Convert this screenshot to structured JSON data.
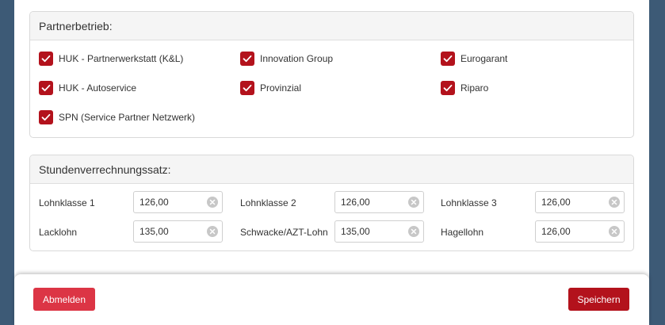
{
  "partner": {
    "title": "Partnerbetrieb:",
    "items": [
      {
        "label": "HUK - Partnerwerkstatt (K&L)",
        "checked": true
      },
      {
        "label": "Innovation Group",
        "checked": true
      },
      {
        "label": "Eurogarant",
        "checked": true
      },
      {
        "label": "HUK - Autoservice",
        "checked": true
      },
      {
        "label": "Provinzial",
        "checked": true
      },
      {
        "label": "Riparo",
        "checked": true
      },
      {
        "label": "SPN (Service Partner Netzwerk)",
        "checked": true
      }
    ]
  },
  "rates": {
    "title": "Stundenverrechnungssatz:",
    "fields": [
      {
        "label": "Lohnklasse 1",
        "value": "126,00"
      },
      {
        "label": "Lohnklasse 2",
        "value": "126,00"
      },
      {
        "label": "Lohnklasse 3",
        "value": "126,00"
      },
      {
        "label": "Lacklohn",
        "value": "135,00"
      },
      {
        "label": "Schwacke/AZT-Lohn",
        "value": "135,00"
      },
      {
        "label": "Hagellohn",
        "value": "126,00"
      }
    ]
  },
  "footer": {
    "logout_label": "Abmelden",
    "save_label": "Speichern"
  },
  "colors": {
    "background": "#3d5a76",
    "checkbox": "#b3121c",
    "logout_button": "#dc3545",
    "save_button": "#b3121c"
  }
}
